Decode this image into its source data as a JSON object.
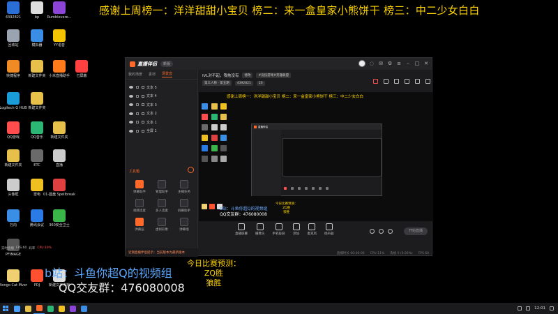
{
  "banner": "感谢上周榜一：洋洋甜甜小宝贝 榜二：来一盒皇家小熊饼干 榜三：中二少女白白",
  "desktop_icons": [
    {
      "label": "4392821",
      "color": "#2a6fd6"
    },
    {
      "label": "bp",
      "color": "#dddddd"
    },
    {
      "label": "Rumblevere...",
      "color": "#8b44d6"
    },
    {
      "label": "回收站",
      "color": "#9aa4b0"
    },
    {
      "label": "模拟器",
      "color": "#3a8ee6"
    },
    {
      "label": "YY语音",
      "color": "#f5c400"
    },
    {
      "label": "快捷程序",
      "color": "#f08a24"
    },
    {
      "label": "新建文件夹",
      "color": "#e6c04a"
    },
    {
      "label": "小米直播助手",
      "color": "#ff7a1a"
    },
    {
      "label": "已屏蔽",
      "color": "#ff4040"
    },
    {
      "label": "Logitech G HUB",
      "color": "#1a9cd8"
    },
    {
      "label": "新建文件夹",
      "color": "#e6c04a"
    },
    {
      "label": "QQ游戏",
      "color": "#ff4d4d"
    },
    {
      "label": "QQ音乐",
      "color": "#2bb673"
    },
    {
      "label": "新建文件夹",
      "color": "#e6c04a"
    },
    {
      "label": "新建文件夹",
      "color": "#e6c04a"
    },
    {
      "label": "ETC",
      "color": "#6a6a6a"
    },
    {
      "label": "直播",
      "color": "#cccccc"
    },
    {
      "label": "头像框",
      "color": "#cccccc"
    },
    {
      "label": "雷电",
      "color": "#f0c020"
    },
    {
      "label": "01-圆盘 Spellbreak",
      "color": "#e04040"
    },
    {
      "label": "万向",
      "color": "#3a8ee6"
    },
    {
      "label": "腾讯会议",
      "color": "#2a7be6"
    },
    {
      "label": "360安全卫士",
      "color": "#3ab54a"
    },
    {
      "label": "PFIMAGE",
      "color": "#555555"
    },
    {
      "label": "Bongo Cat Mver",
      "color": "#f0d070"
    },
    {
      "label": "PDJ",
      "color": "#ff5030"
    },
    {
      "label": "新建文本文档",
      "color": "#dddddd"
    }
  ],
  "app": {
    "logo": "直播伴侣",
    "version": "新版",
    "tabs": [
      "我的场景",
      "素材",
      "场景音"
    ],
    "active_tab": 2,
    "scenes": [
      {
        "name": "文本 5"
      },
      {
        "name": "文本 4"
      },
      {
        "name": "文本 3"
      },
      {
        "name": "文本 2"
      },
      {
        "name": "文本 1"
      },
      {
        "name": "全屏 1"
      }
    ],
    "toolbox_title": "工具箱",
    "tools": [
      {
        "label": "弹幕助手",
        "hot": true
      },
      {
        "label": "管理助手",
        "hot": false
      },
      {
        "label": "主播任务",
        "hot": false
      },
      {
        "label": "视频连麦",
        "hot": false
      },
      {
        "label": "多人连麦",
        "hot": false
      },
      {
        "label": "屏幕助手",
        "hot": false
      },
      {
        "label": "弹幕层",
        "hot": true
      },
      {
        "label": "虚拟形象",
        "hot": false
      },
      {
        "label": "弹幕墙",
        "hot": false
      }
    ],
    "notice": "近期直播伴侣提示：当前版本为最新版本",
    "room": {
      "title": "IVL对不起，我拖没有",
      "chip1": "修改",
      "chip2": "#竞技游戏#英雄联盟",
      "chip3": "第三人称 · 第五期",
      "id": "4392821",
      "count": "20"
    },
    "preview": {
      "banner": "感谢上周榜一：洋洋甜甜小宝贝 榜二：来一盒皇家小熊饼干 榜三：中二少女白白",
      "inner_title": "直播伴侣",
      "b_line": "b站：斗鱼你超Q的视频组",
      "qq_line": "QQ交友群：476080008",
      "pred_title": "今日比赛预测：",
      "pred_1": "ZQ胜",
      "pred_2": "狼胜"
    },
    "controls": [
      {
        "label": "直播屏幕"
      },
      {
        "label": "摄像头"
      },
      {
        "label": "手机投屏"
      },
      {
        "label": "添加"
      },
      {
        "label": "麦克风"
      },
      {
        "label": "扬声器"
      }
    ],
    "start_button": "开始直播",
    "status": [
      "直播时长 00:00:00",
      "CPU 11%",
      "丢帧 0 (0.00%)",
      "FPS 60"
    ]
  },
  "overlay": {
    "b_line": "b站：斗鱼你超Q的视频组",
    "qq_line": "QQ交友群：476080008",
    "pred_title": "今日比赛预测：",
    "pred_1": "ZQ胜",
    "pred_2": "狼胜"
  },
  "small_texts": [
    "实时直播",
    "FPS:60",
    "码率",
    "CPU:19%"
  ],
  "taskbar": {
    "items": [
      "#4aa0ff",
      "#e6c04a",
      "#ff6a2b",
      "#2bb673",
      "#f0c020",
      "#8b44d6",
      "#3a8ee6"
    ],
    "clock": "12:01"
  }
}
